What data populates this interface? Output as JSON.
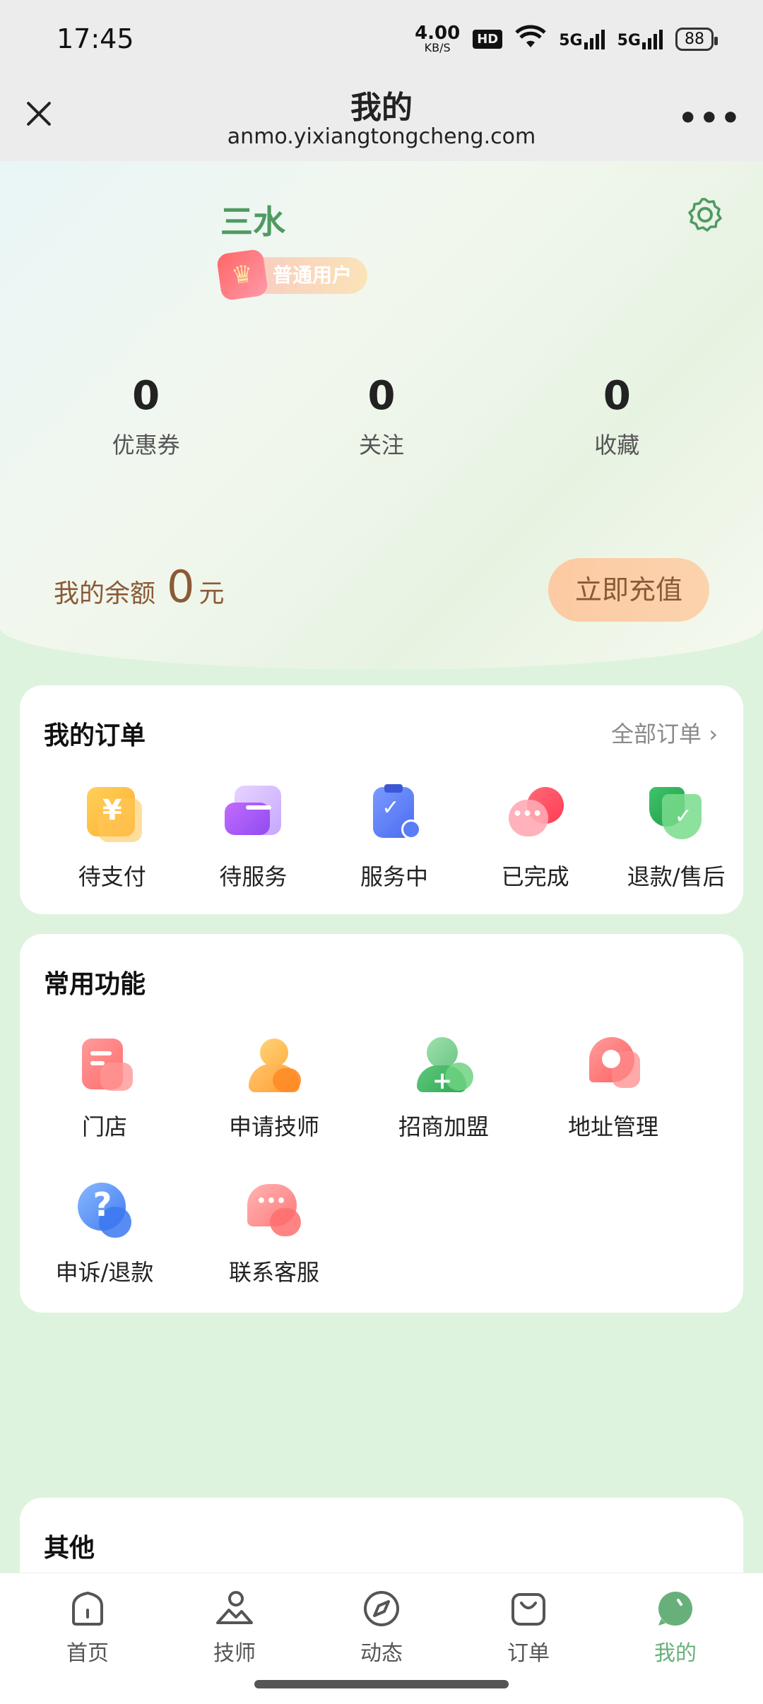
{
  "status": {
    "time": "17:45",
    "net_speed_value": "4.00",
    "net_speed_unit": "KB/S",
    "hd": "HD",
    "sim1": "5G",
    "sim2": "5G",
    "battery": "88"
  },
  "titlebar": {
    "title": "我的",
    "url": "anmo.yixiangtongcheng.com",
    "more": "•••"
  },
  "profile": {
    "username": "三水",
    "badge": "普通用户",
    "stats": [
      {
        "value": "0",
        "label": "优惠券"
      },
      {
        "value": "0",
        "label": "关注"
      },
      {
        "value": "0",
        "label": "收藏"
      }
    ],
    "balance_label": "我的余额",
    "balance_amount": "0",
    "balance_unit": "元",
    "recharge_label": "立即充值"
  },
  "orders": {
    "title": "我的订单",
    "all_link": "全部订单 ›",
    "items": [
      {
        "label": "待支付",
        "icon": "yen-wallet-icon"
      },
      {
        "label": "待服务",
        "icon": "card-icon"
      },
      {
        "label": "服务中",
        "icon": "clipboard-check-icon"
      },
      {
        "label": "已完成",
        "icon": "chat-bubble-icon"
      },
      {
        "label": "退款/售后",
        "icon": "shield-check-icon"
      }
    ]
  },
  "functions": {
    "title": "常用功能",
    "items": [
      {
        "label": "门店",
        "icon": "store-document-icon"
      },
      {
        "label": "申请技师",
        "icon": "technician-icon"
      },
      {
        "label": "招商加盟",
        "icon": "add-user-icon"
      },
      {
        "label": "地址管理",
        "icon": "location-icon"
      },
      {
        "label": "申诉/退款",
        "icon": "question-icon"
      },
      {
        "label": "联系客服",
        "icon": "customer-service-icon"
      }
    ]
  },
  "others": {
    "title": "其他"
  },
  "tabbar": {
    "items": [
      {
        "label": "首页",
        "icon": "home-icon"
      },
      {
        "label": "技师",
        "icon": "technician-tab-icon"
      },
      {
        "label": "动态",
        "icon": "compass-icon"
      },
      {
        "label": "订单",
        "icon": "bag-icon"
      },
      {
        "label": "我的",
        "icon": "profile-tab-icon",
        "active": true
      }
    ]
  },
  "colors": {
    "accent_green": "#68b07a",
    "balance_brown": "#8a5a36",
    "page_bg": "#ddf3dd"
  }
}
